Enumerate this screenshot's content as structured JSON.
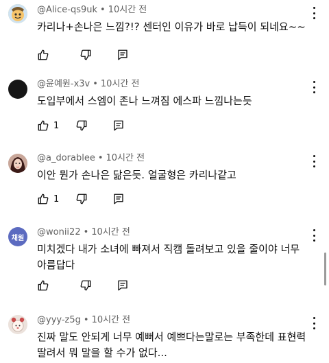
{
  "comments": [
    {
      "handle": "@Alice-qs9uk",
      "time": "10시간 전",
      "text": "카리나+손나은 느낌?!? 센터인 이유가 바로 납득이 되네요~~",
      "likes": "",
      "avatar_icon": "cartoon-avatar-icon",
      "avatar_text": ""
    },
    {
      "handle": "@윤예원-x3v",
      "time": "10시간 전",
      "text": "도입부에서 스엠이 존나 느껴짐 에스파 느낌나는듯",
      "likes": "1",
      "avatar_icon": "dark-avatar-icon",
      "avatar_text": ""
    },
    {
      "handle": "@a_dorablee",
      "time": "10시간 전",
      "text": "이안 뭔가 손나은 닮은듯. 얼굴형은 카리나같고",
      "likes": "1",
      "avatar_icon": "photo-avatar-icon",
      "avatar_text": ""
    },
    {
      "handle": "@wonii22",
      "time": "10시간 전",
      "text": "미치겠다 내가 소녀에 빠져서 직캠 돌려보고 있을 줄이야 너무아름답다",
      "likes": "",
      "avatar_icon": "letter-avatar-icon",
      "avatar_text": "채원"
    },
    {
      "handle": "@yyy-z5g",
      "time": "10시간 전",
      "text": "진짜 말도 안되게 너무 예뻐서 예쁘다는말로는 부족한데 표현력 딸려서 뭐 말을 할 수가 없다...",
      "likes": "",
      "avatar_icon": "character-avatar-icon",
      "avatar_text": ""
    }
  ],
  "icons": {
    "like": "thumbs-up-icon",
    "dislike": "thumbs-down-icon",
    "reply": "reply-icon",
    "more": "more-vertical-icon"
  },
  "colors": {
    "meta_text": "#606060",
    "letter_avatar_bg": "#5c6bc0"
  }
}
